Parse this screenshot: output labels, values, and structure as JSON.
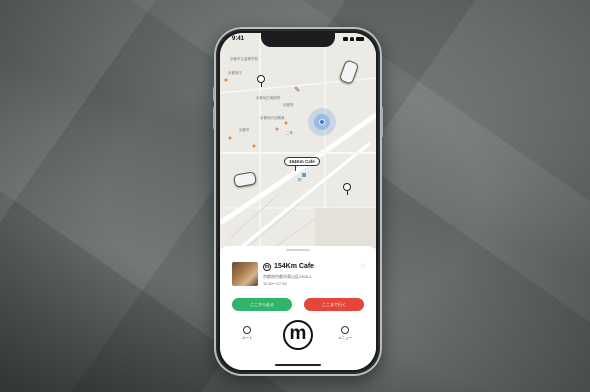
{
  "status_bar": {
    "time": "9:41"
  },
  "map": {
    "callout_label": "154Km Cafe",
    "station_label": "駅"
  },
  "place": {
    "logo_letter": "m",
    "name": "154Km Cafe",
    "address": "京都府京都市東山区2305-4",
    "hours": "11:30〜17:30"
  },
  "actions": {
    "primary_label": "ここから走る",
    "secondary_label": "ここまで行く"
  },
  "tabbar": {
    "left_label": "ルート",
    "center_letter": "m",
    "right_label": "メニュー"
  },
  "colors": {
    "accent_green": "#31b36a",
    "accent_red": "#e5463a",
    "location_blue": "#2f7fd8"
  },
  "icons": {
    "map_pin": "map-pin-icon",
    "car": "car-icon",
    "favorite": "star-icon"
  }
}
